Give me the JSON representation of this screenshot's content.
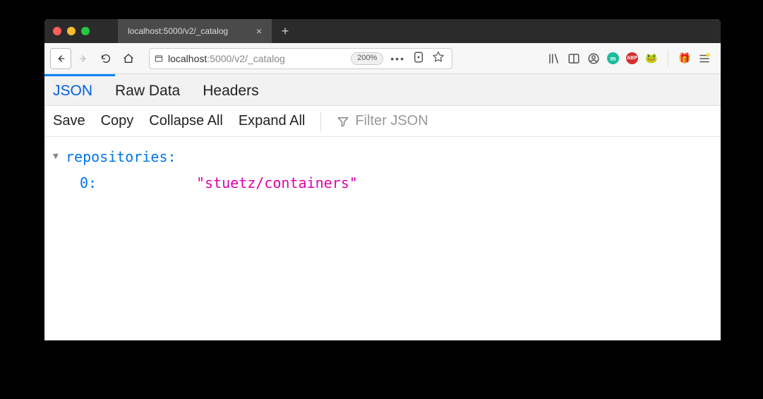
{
  "tab": {
    "title": "localhost:5000/v2/_catalog",
    "close": "×",
    "new": "+"
  },
  "url": {
    "prefix": "localhost",
    "rest": ":5000/v2/_catalog",
    "zoom": "200%"
  },
  "viewer_tabs": {
    "json": "JSON",
    "raw": "Raw Data",
    "headers": "Headers"
  },
  "actions": {
    "save": "Save",
    "copy": "Copy",
    "collapse": "Collapse All",
    "expand": "Expand All",
    "filter_placeholder": "Filter JSON"
  },
  "json": {
    "key": "repositories:",
    "index": "0:",
    "value": "\"stuetz/containers\""
  },
  "icons": {
    "m": "m",
    "abp": "ABP"
  }
}
